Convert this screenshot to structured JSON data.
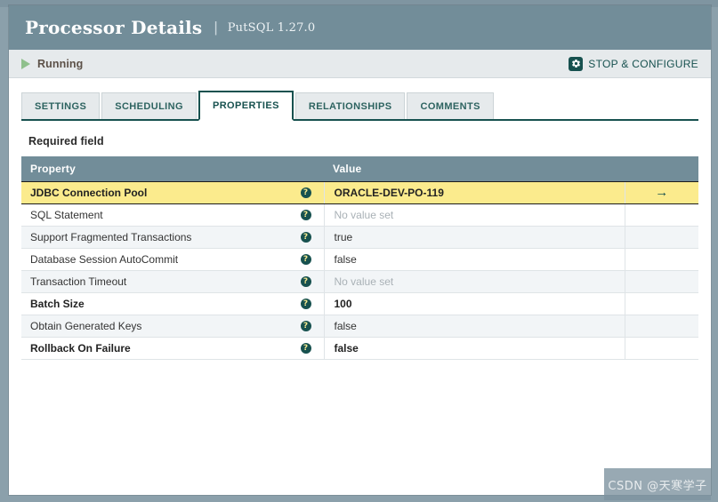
{
  "window": {
    "title": "Processor Details",
    "separator": "|",
    "subtitle": "PutSQL 1.27.0"
  },
  "status_bar": {
    "state_label": "Running",
    "state_icon": "play-triangle-icon",
    "action_label": "STOP & CONFIGURE",
    "action_icon": "gear-icon"
  },
  "tabs": [
    {
      "label": "SETTINGS",
      "active": false
    },
    {
      "label": "SCHEDULING",
      "active": false
    },
    {
      "label": "PROPERTIES",
      "active": true
    },
    {
      "label": "RELATIONSHIPS",
      "active": false
    },
    {
      "label": "COMMENTS",
      "active": false
    }
  ],
  "content": {
    "legend": "Required field"
  },
  "table": {
    "columns": [
      "Property",
      "Value",
      ""
    ],
    "help_glyph": "?",
    "goto_glyph": "→",
    "rows": [
      {
        "property": "JDBC Connection Pool",
        "value": "ORACLE-DEV-PO-119",
        "placeholder": false,
        "required": true,
        "selected": true,
        "has_goto": true
      },
      {
        "property": "SQL Statement",
        "value": "No value set",
        "placeholder": true,
        "required": false,
        "selected": false,
        "has_goto": false
      },
      {
        "property": "Support Fragmented Transactions",
        "value": "true",
        "placeholder": false,
        "required": false,
        "selected": false,
        "has_goto": false
      },
      {
        "property": "Database Session AutoCommit",
        "value": "false",
        "placeholder": false,
        "required": false,
        "selected": false,
        "has_goto": false
      },
      {
        "property": "Transaction Timeout",
        "value": "No value set",
        "placeholder": true,
        "required": false,
        "selected": false,
        "has_goto": false
      },
      {
        "property": "Batch Size",
        "value": "100",
        "placeholder": false,
        "required": true,
        "selected": false,
        "has_goto": false
      },
      {
        "property": "Obtain Generated Keys",
        "value": "false",
        "placeholder": false,
        "required": false,
        "selected": false,
        "has_goto": false
      },
      {
        "property": "Rollback On Failure",
        "value": "false",
        "placeholder": false,
        "required": true,
        "selected": false,
        "has_goto": false
      }
    ]
  },
  "watermark": {
    "text": "CSDN @天寒学子"
  },
  "colors": {
    "header_bg": "#728d99",
    "accent_dark": "#17514f",
    "selected_row": "#fbeb8d",
    "status_bg": "#e6eaec",
    "running_green": "#8fc08c"
  }
}
